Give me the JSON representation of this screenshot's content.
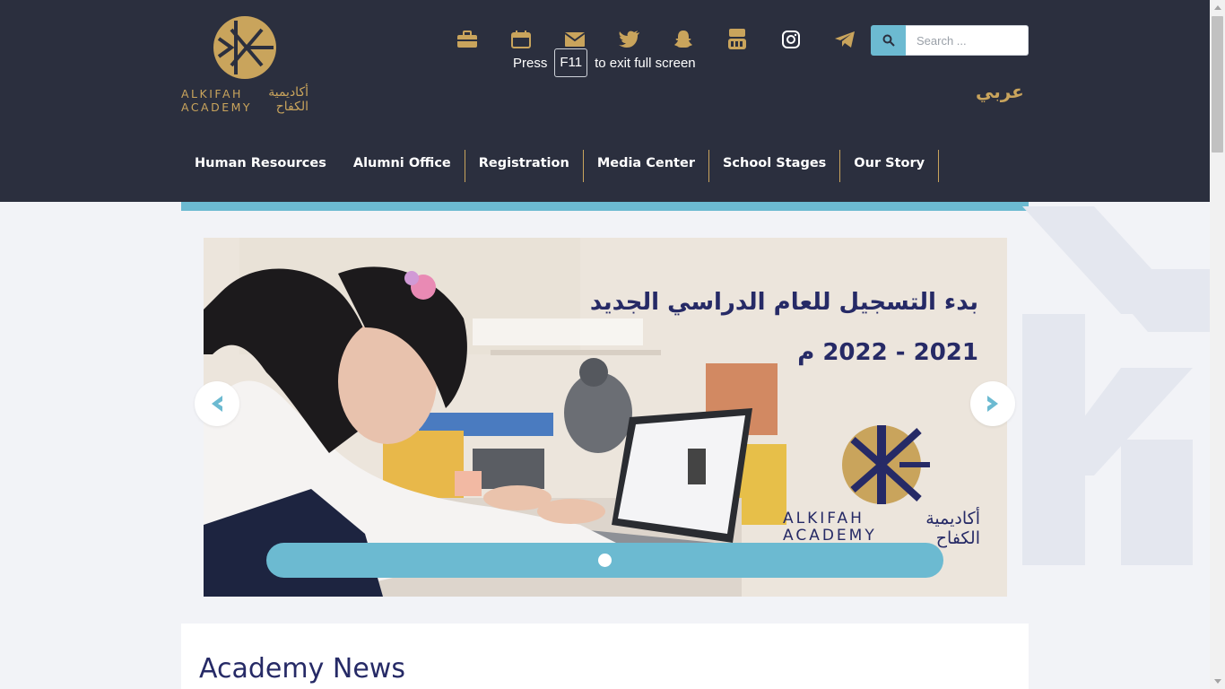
{
  "header": {
    "logo": {
      "name_en": [
        "ALKIFAH",
        "ACADEMY"
      ],
      "name_ar": [
        "أكاديمية",
        "الكفاح"
      ]
    },
    "social_icons": [
      "briefcase-icon",
      "calendar-icon",
      "mail-icon",
      "twitter-icon",
      "snapchat-icon",
      "youtube-icon",
      "instagram-icon",
      "telegram-icon"
    ],
    "search": {
      "placeholder": "Search ..."
    },
    "language_link": "عربي",
    "nav": [
      "Human Resources",
      "Alumni Office",
      "Registration",
      "Media Center",
      "School Stages",
      "Our Story"
    ]
  },
  "fullscreen_notice": {
    "press": "Press",
    "key": "F11",
    "rest": "to exit full screen"
  },
  "slider": {
    "headline": [
      "بدء التسجيل للعام الدراسي الجديد",
      "2021 - 2022 م"
    ],
    "logo_en": [
      "ALKIFAH",
      "ACADEMY"
    ],
    "logo_ar": [
      "أكاديمية",
      "الكفاح"
    ],
    "active_slide": 1,
    "slide_count": 1
  },
  "news": {
    "title": "Academy News"
  },
  "colors": {
    "header_bg": "#2b2f3e",
    "gold": "#c9a45c",
    "accent": "#6cbad1",
    "navy": "#262a66",
    "page_bg": "#f2f3f7"
  }
}
